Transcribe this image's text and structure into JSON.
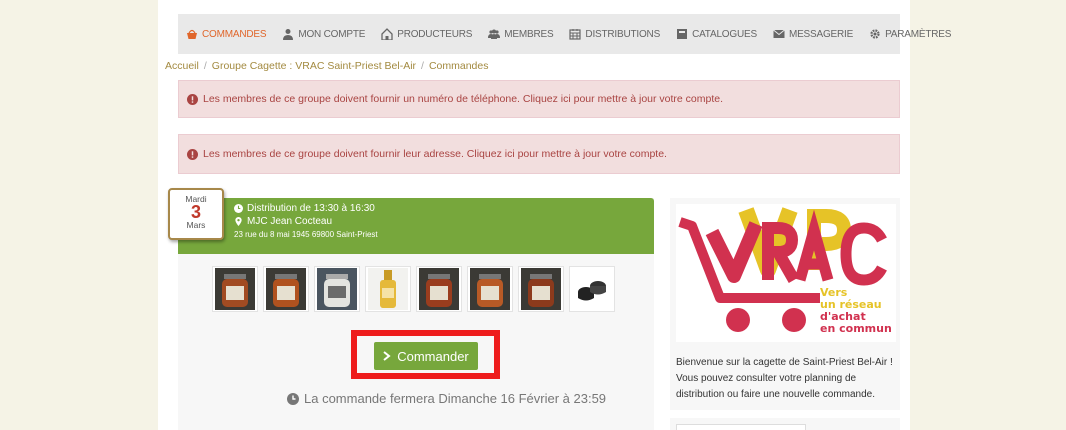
{
  "nav": {
    "items": [
      {
        "label": "COMMANDES",
        "icon": "basket-icon",
        "active": true
      },
      {
        "label": "MON COMPTE",
        "icon": "user-icon"
      },
      {
        "label": "PRODUCTEURS",
        "icon": "farm-icon"
      },
      {
        "label": "MEMBRES",
        "icon": "users-icon"
      },
      {
        "label": "DISTRIBUTIONS",
        "icon": "calendar-icon"
      },
      {
        "label": "CATALOGUES",
        "icon": "book-icon"
      },
      {
        "label": "MESSAGERIE",
        "icon": "envelope-icon"
      },
      {
        "label": "PARAMÈTRES",
        "icon": "gear-icon"
      }
    ]
  },
  "breadcrumb": {
    "home": "Accueil",
    "group": "Groupe Cagette : VRAC Saint-Priest Bel-Air",
    "current": "Commandes",
    "separator": "/"
  },
  "alerts": {
    "phone": "Les membres de ce groupe doivent fournir un numéro de téléphone. Cliquez ici pour mettre à jour votre compte.",
    "address": "Les membres de ce groupe doivent fournir leur adresse. Cliquez ici pour mettre à jour votre compte."
  },
  "distribution": {
    "day": "Mardi",
    "date": "3",
    "month": "Mars",
    "time": "Distribution de 13:30 à 16:30",
    "place": "MJC Jean Cocteau",
    "address": "23 rue du 8 mai 1945 69800 Saint-Priest",
    "order_button": "Commander",
    "close_note": "La commande fermera Dimanche 16 Février à 23:59"
  },
  "sidebar": {
    "logo_title": "VRAC",
    "logo_tagline": [
      "Vers",
      "un réseau",
      "d'achat",
      "en commun"
    ],
    "welcome": "Bienvenue sur la cagette de Saint-Priest Bel-Air ! Vous pouvez consulter votre planning de distribution ou faire une nouvelle commande."
  },
  "colors": {
    "accent_orange": "#e0662b",
    "green": "#77a73c",
    "alert_bg": "#f2dede",
    "alert_text": "#a94442",
    "highlight_red": "#ee1c1c",
    "vrac_red": "#d1314f",
    "vrac_yellow": "#e6c327"
  }
}
